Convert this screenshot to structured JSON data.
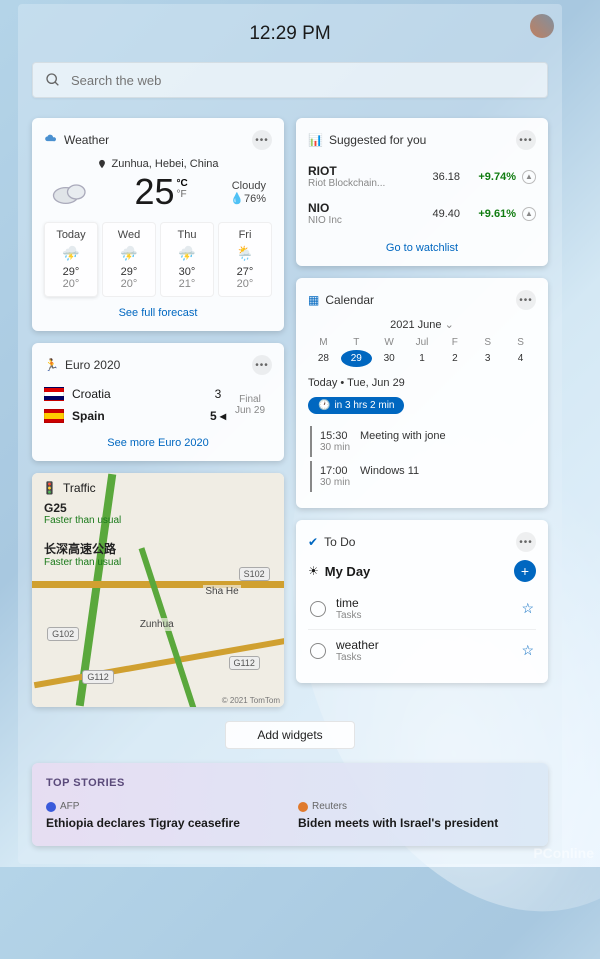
{
  "header": {
    "time": "12:29 PM"
  },
  "search": {
    "placeholder": "Search the web"
  },
  "weather": {
    "title": "Weather",
    "location": "Zunhua, Hebei, China",
    "temp": "25",
    "unit_c": "°C",
    "unit_f": "°F",
    "condition": "Cloudy",
    "humidity": "76%",
    "link": "See full forecast",
    "days": [
      {
        "name": "Today",
        "hi": "29°",
        "lo": "20°"
      },
      {
        "name": "Wed",
        "hi": "29°",
        "lo": "20°"
      },
      {
        "name": "Thu",
        "hi": "30°",
        "lo": "21°"
      },
      {
        "name": "Fri",
        "hi": "27°",
        "lo": "20°"
      }
    ]
  },
  "stocks": {
    "title": "Suggested for you",
    "link": "Go to watchlist",
    "items": [
      {
        "sym": "RIOT",
        "name": "Riot Blockchain...",
        "price": "36.18",
        "chg": "+9.74%"
      },
      {
        "sym": "NIO",
        "name": "NIO Inc",
        "price": "49.40",
        "chg": "+9.61%"
      }
    ]
  },
  "euro": {
    "title": "Euro 2020",
    "link": "See more Euro 2020",
    "final": "Final",
    "date": "Jun 29",
    "match": [
      {
        "team": "Croatia",
        "score": "3",
        "flag": "hr",
        "win": false
      },
      {
        "team": "Spain",
        "score": "5",
        "flag": "es",
        "win": true
      }
    ]
  },
  "traffic": {
    "title": "Traffic",
    "route": "G25",
    "status": "Faster than usual",
    "route2": "长深高速公路",
    "status2": "Faster than usual",
    "city": "Zunhua",
    "place": "Sha He",
    "copyright": "© 2021 TomTom",
    "pins": [
      "G102",
      "S102",
      "G112",
      "G112"
    ]
  },
  "calendar": {
    "title": "Calendar",
    "month": "2021 June",
    "dow": [
      "M",
      "T",
      "W",
      "Jul",
      "F",
      "S",
      "S"
    ],
    "days": [
      "28",
      "29",
      "30",
      "1",
      "2",
      "3",
      "4"
    ],
    "today_idx": 1,
    "today_label": "Today • Tue, Jun 29",
    "badge": "in 3 hrs 2 min",
    "events": [
      {
        "time": "15:30",
        "dur": "30 min",
        "title": "Meeting with jone"
      },
      {
        "time": "17:00",
        "dur": "30 min",
        "title": "Windows 11"
      }
    ]
  },
  "todo": {
    "title": "To Do",
    "list": "My Day",
    "tasks": [
      {
        "title": "time",
        "sub": "Tasks"
      },
      {
        "title": "weather",
        "sub": "Tasks"
      }
    ]
  },
  "add_widgets": "Add widgets",
  "news": {
    "head": "TOP STORIES",
    "items": [
      {
        "src": "AFP",
        "title": "Ethiopia declares Tigray ceasefire",
        "color": "#3a5adb"
      },
      {
        "src": "Reuters",
        "title": "Biden meets with Israel's president",
        "color": "#e07a2c"
      }
    ]
  },
  "watermark": "PConline"
}
